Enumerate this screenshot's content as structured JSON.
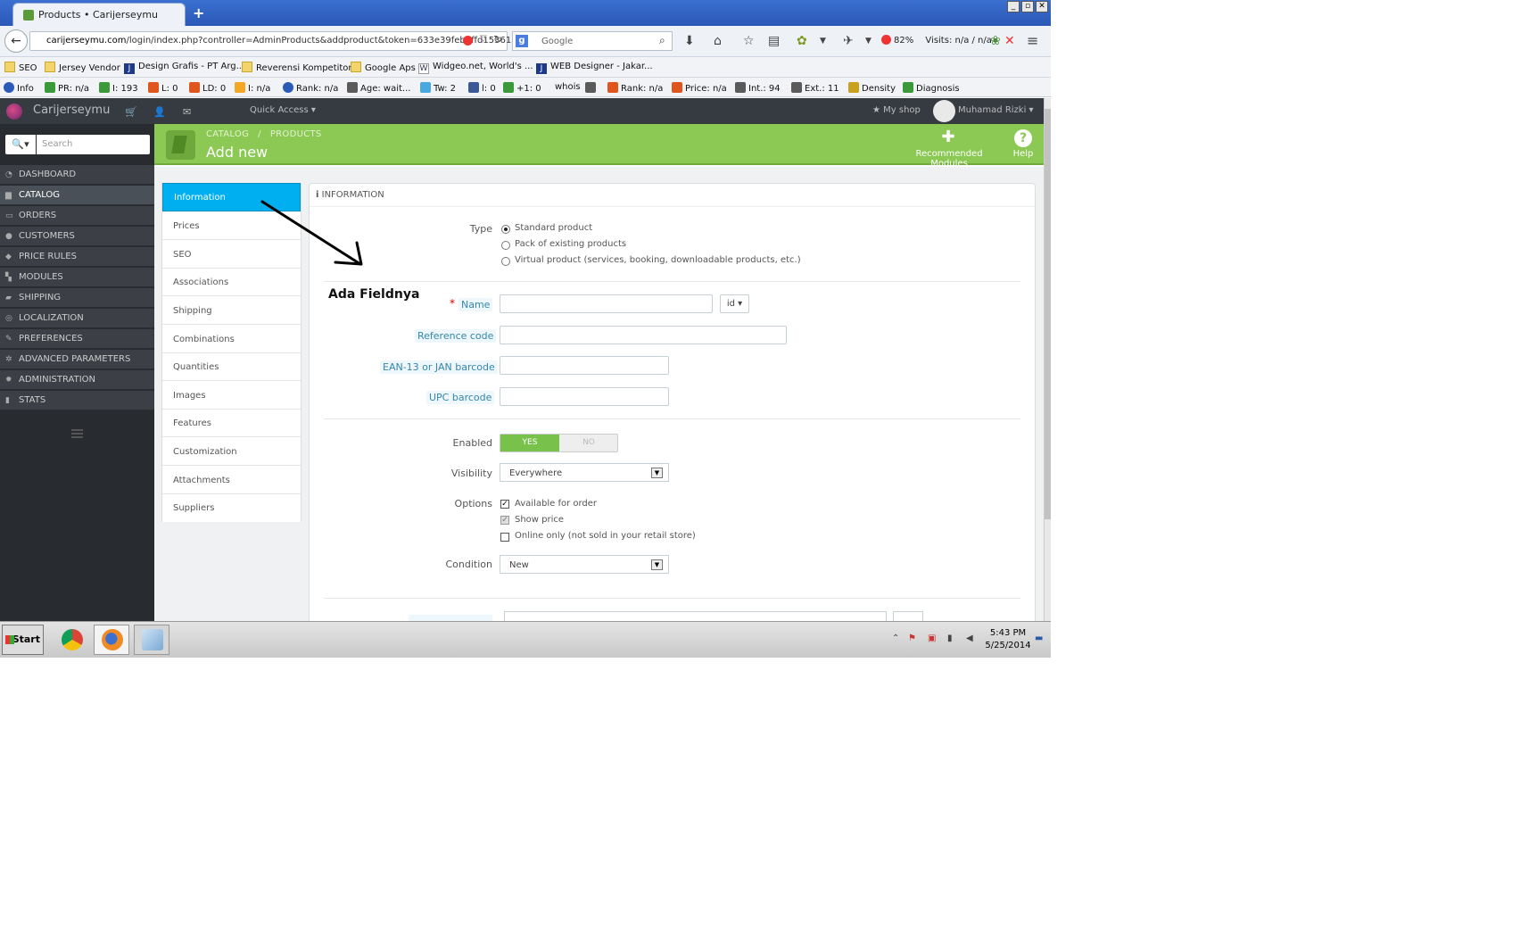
{
  "browser": {
    "tab_title": "Products • Carijerseymu",
    "new_tab": "+",
    "url_host": "carijerseymu.com",
    "url_path": "/login/index.php?controller=AdminProducts&addproduct&token=633e39feb9ffd153615",
    "search_placeholder": "Google",
    "zoom_block": "82%",
    "visits": "Visits: n/a / n/a"
  },
  "bookmarks": [
    {
      "label": "SEO",
      "icon": "folder-icon"
    },
    {
      "label": "Jersey Vendor",
      "icon": "folder-icon"
    },
    {
      "label": "Design Grafis - PT Arg...",
      "icon": "j-icon"
    },
    {
      "label": "Reverensi Kompetitor",
      "icon": "folder-icon"
    },
    {
      "label": "Google Aps",
      "icon": "folder-icon"
    },
    {
      "label": "Widgeo.net, World's ...",
      "icon": "w-icon"
    },
    {
      "label": "WEB Designer - Jakar...",
      "icon": "j-icon"
    }
  ],
  "seobar": [
    {
      "label": "Info",
      "icon": "info-icon"
    },
    {
      "label": "PR: n/a",
      "icon": "google-icon"
    },
    {
      "label": "I: 193",
      "icon": "google-icon"
    },
    {
      "label": "L: 0",
      "icon": "yahoo-icon"
    },
    {
      "label": "LD: 0",
      "icon": "yahoo-icon"
    },
    {
      "label": "I: n/a",
      "icon": "bing-icon"
    },
    {
      "label": "Rank: n/a",
      "icon": "alexa-icon"
    },
    {
      "label": "Age: wait...",
      "icon": "archive-icon"
    },
    {
      "label": "Tw: 2",
      "icon": "twitter-icon"
    },
    {
      "label": "l: 0",
      "icon": "facebook-icon"
    },
    {
      "label": "+1: 0",
      "icon": "google-icon"
    },
    {
      "label": "whois",
      "icon": "whois-icon"
    },
    {
      "label": "",
      "icon": "source-icon"
    },
    {
      "label": "Rank: n/a",
      "icon": "rank-icon"
    },
    {
      "label": "Price: n/a",
      "icon": "price-icon"
    },
    {
      "label": "Int.: 94",
      "icon": "link-icon"
    },
    {
      "label": "Ext.: 11",
      "icon": "link-icon"
    },
    {
      "label": "Density",
      "icon": "density-icon"
    },
    {
      "label": "Diagnosis",
      "icon": "diagnosis-icon"
    }
  ],
  "admin": {
    "shop_name": "Carijerseymu",
    "quick_access": "Quick Access",
    "my_shop": "My shop",
    "user": "Muhamad Rizki",
    "search_placeholder": "Search"
  },
  "sidebar_menu": [
    {
      "label": "DASHBOARD",
      "active": false
    },
    {
      "label": "CATALOG",
      "active": true
    },
    {
      "label": "ORDERS",
      "active": false
    },
    {
      "label": "CUSTOMERS",
      "active": false
    },
    {
      "label": "PRICE RULES",
      "active": false
    },
    {
      "label": "MODULES",
      "active": false
    },
    {
      "label": "SHIPPING",
      "active": false
    },
    {
      "label": "LOCALIZATION",
      "active": false
    },
    {
      "label": "PREFERENCES",
      "active": false
    },
    {
      "label": "ADVANCED PARAMETERS",
      "active": false
    },
    {
      "label": "ADMINISTRATION",
      "active": false
    },
    {
      "label": "STATS",
      "active": false
    }
  ],
  "page": {
    "breadcrumb_1": "CATALOG",
    "breadcrumb_2": "PRODUCTS",
    "title": "Add new",
    "recommended_modules": "Recommended Modules",
    "help": "Help"
  },
  "product_tabs": [
    "Information",
    "Prices",
    "SEO",
    "Associations",
    "Shipping",
    "Combinations",
    "Quantities",
    "Images",
    "Features",
    "Customization",
    "Attachments",
    "Suppliers"
  ],
  "form": {
    "panel_title": "INFORMATION",
    "type_label": "Type",
    "type_options": [
      "Standard product",
      "Pack of existing products",
      "Virtual product (services, booking, downloadable products, etc.)"
    ],
    "annotation": "Ada Fieldnya",
    "required_mark": "*",
    "name_label": "Name",
    "lang": "id",
    "reference_label": "Reference code",
    "ean_label": "EAN-13 or JAN barcode",
    "upc_label": "UPC barcode",
    "enabled_label": "Enabled",
    "yes": "YES",
    "no": "NO",
    "visibility_label": "Visibility",
    "visibility_value": "Everywhere",
    "options_label": "Options",
    "option_1": "Available for order",
    "option_2": "Show price",
    "option_3": "Online only (not sold in your retail store)",
    "condition_label": "Condition",
    "condition_value": "New"
  },
  "taskbar": {
    "start": "Start",
    "time": "5:43 PM",
    "date": "5/25/2014"
  }
}
